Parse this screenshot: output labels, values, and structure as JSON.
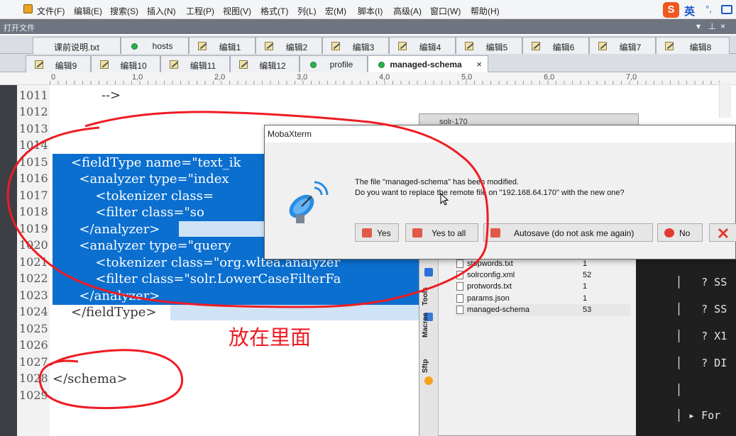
{
  "menu": [
    "文件(F)",
    "编辑(E)",
    "搜索(S)",
    "插入(N)",
    "工程(P)",
    "视图(V)",
    "格式(T)",
    "列(L)",
    "宏(M)",
    "脚本(I)",
    "高级(A)",
    "窗口(W)",
    "帮助(H)"
  ],
  "ime": {
    "label": "英",
    "punct": "°,"
  },
  "panel": {
    "title": "打开文件",
    "controls": [
      "▾",
      "⊥",
      "×"
    ]
  },
  "tabs_row1": [
    {
      "label": "课前说明.txt",
      "icon": "none"
    },
    {
      "label": "hosts",
      "icon": "dot"
    },
    {
      "label": "编辑1",
      "icon": "edit"
    },
    {
      "label": "编辑2",
      "icon": "edit"
    },
    {
      "label": "编辑3",
      "icon": "edit"
    },
    {
      "label": "编辑4",
      "icon": "edit"
    },
    {
      "label": "编辑5",
      "icon": "edit"
    },
    {
      "label": "编辑6",
      "icon": "edit"
    },
    {
      "label": "编辑7",
      "icon": "edit"
    },
    {
      "label": "编辑8",
      "icon": "edit"
    }
  ],
  "tabs_row2": [
    {
      "label": "编辑9",
      "icon": "edit"
    },
    {
      "label": "编辑10",
      "icon": "edit"
    },
    {
      "label": "编辑11",
      "icon": "edit"
    },
    {
      "label": "编辑12",
      "icon": "edit"
    },
    {
      "label": "profile",
      "icon": "dot"
    },
    {
      "label": "managed-schema",
      "icon": "dot",
      "active": true,
      "close": "×"
    }
  ],
  "ruler": [
    "0",
    "1,0",
    "2,0",
    "3,0",
    "4,0",
    "5,0",
    "6,0",
    "7,0"
  ],
  "line_numbers": [
    "1011",
    "1012",
    "1013",
    "1014",
    "1015",
    "1016",
    "1017",
    "1018",
    "1019",
    "1020",
    "1021",
    "1022",
    "1023",
    "1024",
    "1025",
    "1026",
    "1027",
    "1028",
    "1029"
  ],
  "code": {
    "l1011": "    -->",
    "l1015": "<fieldType name=\"text_ik",
    "l1016": "  <analyzer type=\"index",
    "l1017": "      <tokenizer class=",
    "l1018": "      <filter class=\"so",
    "l1019": "  </analyzer>",
    "l1020": "  <analyzer type=\"query",
    "l1021": "      <tokenizer class=\"org.wltea.analyzer",
    "l1022": "      <filter class=\"solr.LowerCaseFilterFa",
    "l1023": "  </analyzer>",
    "l1024": "</fieldType>",
    "l1028": "</schema>"
  },
  "moba": {
    "title": "solr-170",
    "side_tabs": [
      "Tools",
      "Macros",
      "Sftp"
    ],
    "files": [
      {
        "name": "stopwords.txt",
        "size": "1"
      },
      {
        "name": "solrconfig.xml",
        "size": "52"
      },
      {
        "name": "protwords.txt",
        "size": "1"
      },
      {
        "name": "params.json",
        "size": "1"
      },
      {
        "name": "managed-schema",
        "size": "53"
      }
    ]
  },
  "terminal": {
    "lines": [
      "│   ? SS",
      "│   ? SS",
      "│   ? X1",
      "│   ? DI",
      "│",
      "│ ▸ For"
    ]
  },
  "dialog": {
    "title": "MobaXterm",
    "line1": "The file \"managed-schema\" has been modified.",
    "line2": "Do you want to replace the remote file on \"192.168.64.170\" with the new one?",
    "buttons": {
      "yes": "Yes",
      "yes_all": "Yes to all",
      "autosave": "Autosave (do not ask me again)",
      "no": "No"
    }
  },
  "annotation": {
    "text": "放在里面",
    "color": "#ee1c24"
  },
  "colors": {
    "selection": "#0b6fcf",
    "accent": "#2bb24c"
  }
}
